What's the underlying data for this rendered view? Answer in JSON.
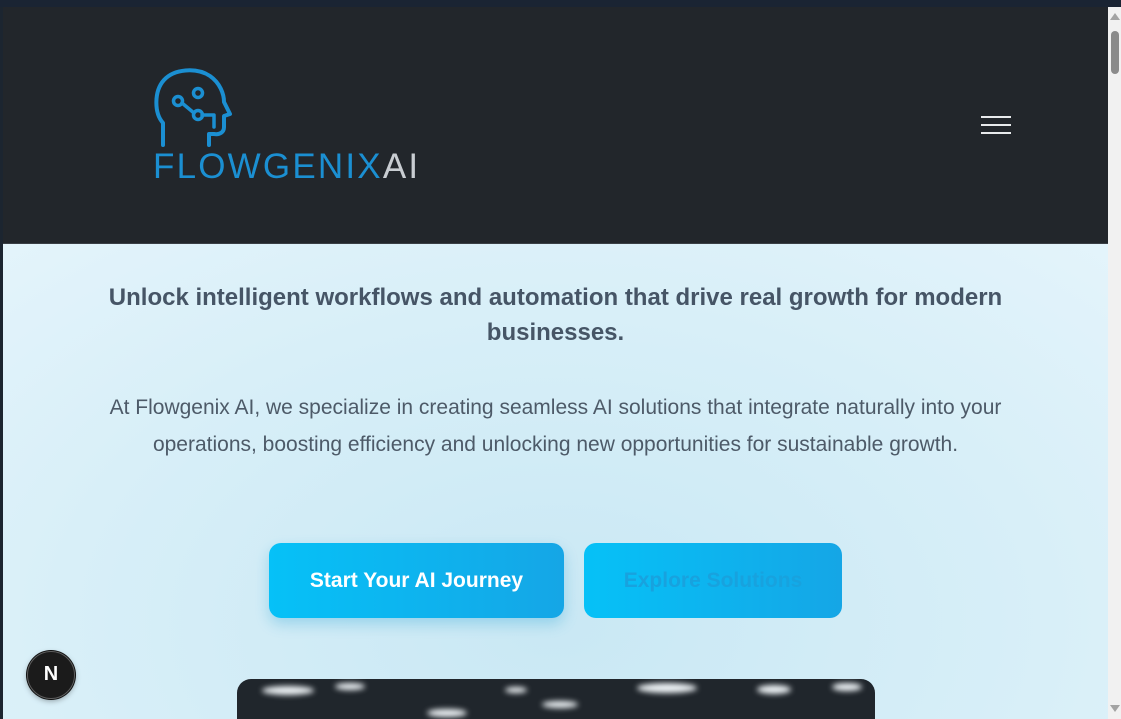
{
  "brand": {
    "name": "FLOWGENIX",
    "suffix": "AI",
    "primary_color": "#1b8fd2",
    "suffix_color": "#c9cdd2"
  },
  "header": {
    "background": "#22262b",
    "menu_icon": "hamburger-menu-icon"
  },
  "hero": {
    "tagline": "Unlock intelligent workflows and automation that drive real growth for modern businesses.",
    "description": "At Flowgenix AI, we specialize in creating seamless AI solutions that integrate naturally into your operations, boosting efficiency and unlocking new opportunities for sustainable growth.",
    "primary_cta": "Start Your AI Journey",
    "secondary_cta": "Explore Solutions",
    "accent_color": "#06c1f7"
  },
  "dev_badge": {
    "letter": "N",
    "icon": "nextjs-dev-indicator-icon"
  }
}
